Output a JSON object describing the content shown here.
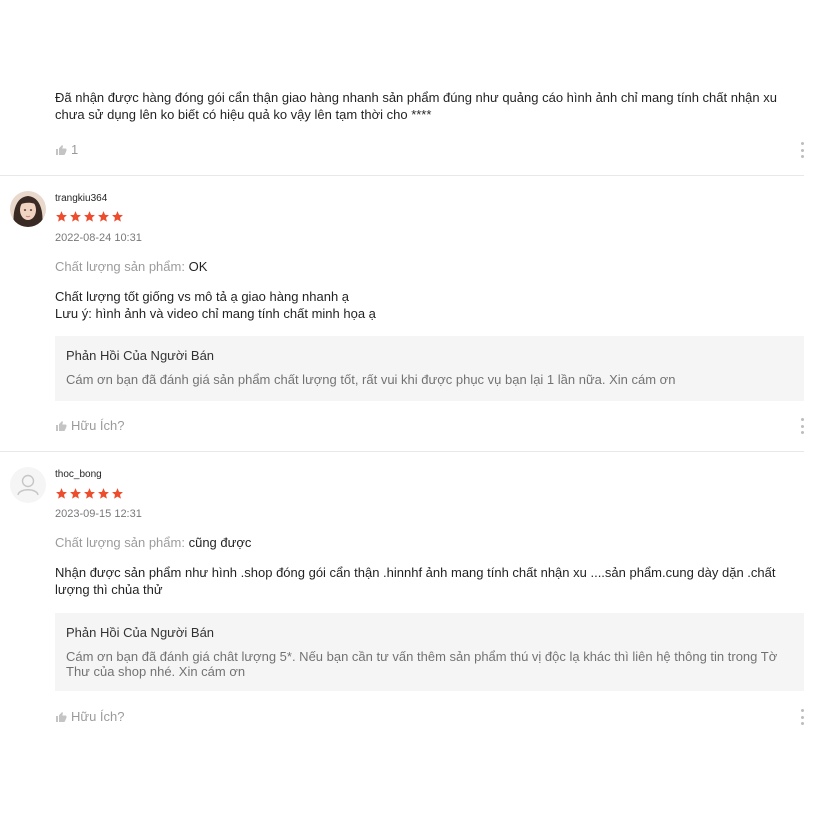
{
  "colors": {
    "star": "#ee4d2d",
    "reply_bg": "#f5f5f5",
    "divider": "#e8e8e8"
  },
  "review_0": {
    "text": "Đã nhận được hàng đóng gói cẩn thận giao hàng nhanh sản phẩm đúng như quảng cáo hình ảnh chỉ mang tính chất nhận xu chưa sử dụng lên ko biết có hiệu quả ko vậy lên tạm thời cho ****",
    "like_count": "1",
    "like_icon": "thumbs-up-icon",
    "more_icon": "more-vertical-icon"
  },
  "review_1": {
    "username": "trangkiu364",
    "rating": 5,
    "date": "2022-08-24 10:31",
    "quality_label": "Chất lượng sản phẩm:",
    "quality_value": "OK",
    "text_lines": [
      "Chất lượng tốt giống vs mô tả ạ giao hàng nhanh ạ",
      "Lưu ý: hình ảnh và video chỉ mang tính chất minh họa ạ"
    ],
    "reply_title": "Phản Hồi Của Người Bán",
    "reply_text": "Cám ơn bạn đã đánh giá sản phẩm chất lượng tốt, rất vui khi được phục vụ bạn lại 1 lần nữa. Xin cám ơn",
    "helpful": "Hữu Ích?"
  },
  "review_2": {
    "username": "thoc_bong",
    "rating": 5,
    "date": "2023-09-15 12:31",
    "quality_label": "Chất lượng sản phẩm:",
    "quality_value": "cũng được",
    "text": "Nhận được sản phẩm như hình .shop đóng gói cẩn thận .hinnhf ảnh mang tính chất nhận xu ....sản phẩm.cung dày dặn .chất lượng thì chủa thử",
    "reply_title": "Phản Hồi Của Người Bán",
    "reply_text": "Cám ơn bạn đã đánh giá chât lượng 5*. Nếu bạn cần tư vấn thêm sản phẩm thú vị độc lạ khác thì liên hệ thông tin trong Tờ Thư của shop nhé. Xin cám ơn",
    "helpful": "Hữu Ích?"
  }
}
